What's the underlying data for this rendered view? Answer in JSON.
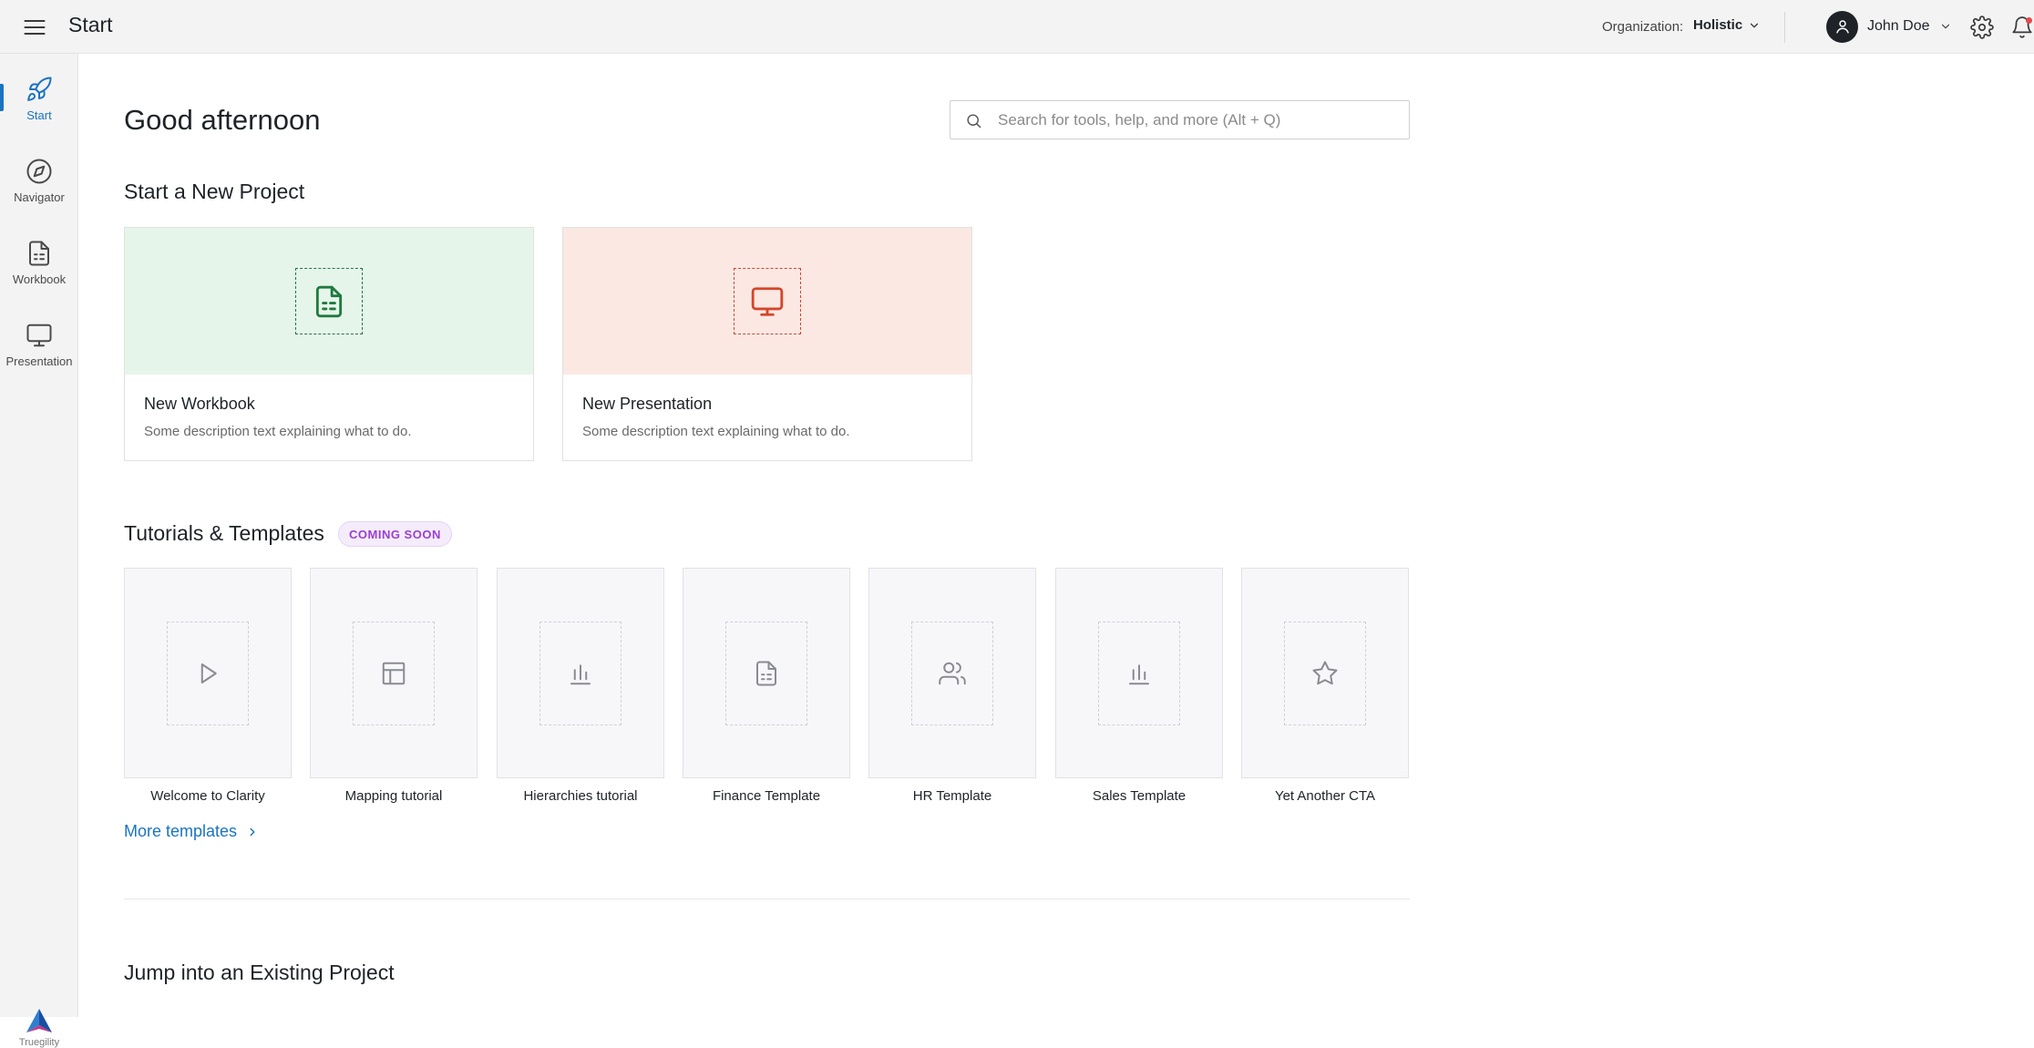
{
  "header": {
    "title": "Start",
    "organization_label": "Organization:",
    "organization_value": "Holistic",
    "user_name": "John Doe",
    "icons": [
      "menu-icon",
      "chevron-down-icon",
      "user-icon",
      "gear-icon",
      "bell-icon"
    ]
  },
  "sidebar": {
    "items": [
      {
        "label": "Start",
        "icon": "rocket-icon",
        "active": true
      },
      {
        "label": "Navigator",
        "icon": "compass-icon",
        "active": false
      },
      {
        "label": "Workbook",
        "icon": "workbook-icon",
        "active": false
      },
      {
        "label": "Presentation",
        "icon": "monitor-icon",
        "active": false
      }
    ],
    "brand_name": "Truegility"
  },
  "main": {
    "greeting": "Good afternoon",
    "search_placeholder": "Search for tools, help, and more (Alt + Q)",
    "new_project_title": "Start a New Project",
    "new_project_cards": [
      {
        "title": "New Workbook",
        "description": "Some description text explaining what to do.",
        "accent": "#1f7a3e",
        "bg": "#e6f5ea"
      },
      {
        "title": "New Presentation",
        "description": "Some description text explaining what to do.",
        "accent": "#d4462b",
        "bg": "#fbe8e3"
      }
    ],
    "tutorials_title": "Tutorials & Templates",
    "tutorials_badge": "COMING SOON",
    "templates": [
      {
        "label": "Welcome to Clarity",
        "icon": "play-icon"
      },
      {
        "label": "Mapping tutorial",
        "icon": "table-icon"
      },
      {
        "label": "Hierarchies tutorial",
        "icon": "bar-chart-icon"
      },
      {
        "label": "Finance Template",
        "icon": "document-icon"
      },
      {
        "label": "HR Template",
        "icon": "users-icon"
      },
      {
        "label": "Sales Template",
        "icon": "bar-chart-icon"
      },
      {
        "label": "Yet Another CTA",
        "icon": "star-icon"
      }
    ],
    "more_templates": "More templates",
    "existing_project_title": "Jump into an Existing Project"
  },
  "colors": {
    "accent": "#1a73c2",
    "badge_text": "#9a3fd4",
    "badge_bg": "#f4ecfb"
  }
}
